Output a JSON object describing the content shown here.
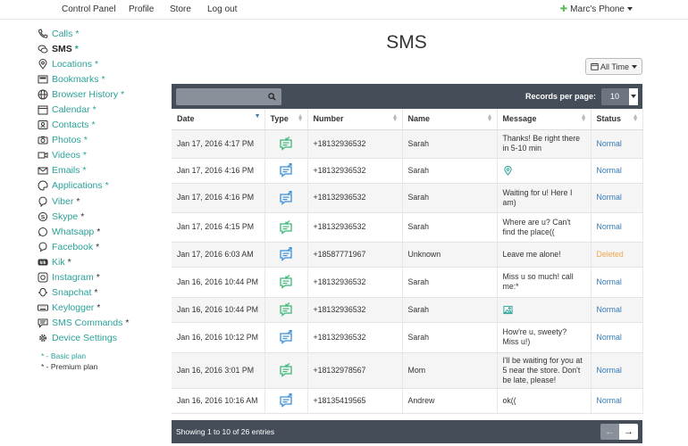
{
  "nav": {
    "control_panel": "Control Panel",
    "profile": "Profile",
    "store": "Store",
    "logout": "Log out",
    "device": "Marc's Phone"
  },
  "sidebar": {
    "items": [
      {
        "label": "Calls",
        "mark": "*",
        "tier": "basic",
        "icon": "phone-icon"
      },
      {
        "label": "SMS",
        "mark": "*",
        "tier": "basic",
        "icon": "chat-icon",
        "active": true
      },
      {
        "label": "Locations",
        "mark": "*",
        "tier": "basic",
        "icon": "map-pin-icon"
      },
      {
        "label": "Bookmarks",
        "mark": "*",
        "tier": "basic",
        "icon": "bookmark-icon"
      },
      {
        "label": "Browser History",
        "mark": "*",
        "tier": "basic",
        "icon": "globe-icon"
      },
      {
        "label": "Calendar",
        "mark": "*",
        "tier": "basic",
        "icon": "calendar-icon"
      },
      {
        "label": "Contacts",
        "mark": "*",
        "tier": "basic",
        "icon": "contacts-icon"
      },
      {
        "label": "Photos",
        "mark": "*",
        "tier": "basic",
        "icon": "camera-icon"
      },
      {
        "label": "Videos",
        "mark": "*",
        "tier": "basic",
        "icon": "video-icon"
      },
      {
        "label": "Emails",
        "mark": "*",
        "tier": "basic",
        "icon": "envelope-icon"
      },
      {
        "label": "Applications",
        "mark": "*",
        "tier": "basic",
        "icon": "palette-icon"
      },
      {
        "label": "Viber",
        "mark": "*",
        "tier": "premium",
        "icon": "viber-icon"
      },
      {
        "label": "Skype",
        "mark": "*",
        "tier": "premium",
        "icon": "skype-icon"
      },
      {
        "label": "Whatsapp",
        "mark": "*",
        "tier": "premium",
        "icon": "whatsapp-icon"
      },
      {
        "label": "Facebook",
        "mark": "*",
        "tier": "premium",
        "icon": "facebook-icon"
      },
      {
        "label": "Kik",
        "mark": "*",
        "tier": "premium",
        "icon": "kik-icon"
      },
      {
        "label": "Instagram",
        "mark": "*",
        "tier": "premium",
        "icon": "instagram-icon"
      },
      {
        "label": "Snapchat",
        "mark": "*",
        "tier": "premium",
        "icon": "snapchat-icon"
      },
      {
        "label": "Keylogger",
        "mark": "*",
        "tier": "premium",
        "icon": "keyboard-icon"
      },
      {
        "label": "SMS Commands",
        "mark": "*",
        "tier": "premium",
        "icon": "chat-lines-icon"
      },
      {
        "label": "Device Settings",
        "mark": "",
        "tier": "none",
        "icon": "gear-icon"
      }
    ],
    "legend_basic": "* - Basic plan",
    "legend_premium": "* - Premium plan"
  },
  "page": {
    "title": "SMS",
    "time_filter": "All Time"
  },
  "table": {
    "records_label": "Records per page:",
    "records_value": "10",
    "columns": [
      "Date",
      "Type",
      "Number",
      "Name",
      "Message",
      "Status"
    ],
    "rows": [
      {
        "date": "Jan 17, 2016 4:17 PM",
        "type": "incoming",
        "number": "+18132936532",
        "name": "Sarah",
        "message": "Thanks! Be right there in 5-10 min",
        "status": "Normal"
      },
      {
        "date": "Jan 17, 2016 4:16 PM",
        "type": "outgoing",
        "number": "+18132936532",
        "name": "Sarah",
        "message": "",
        "message_icon": "location-pin-icon",
        "status": "Normal"
      },
      {
        "date": "Jan 17, 2016 4:16 PM",
        "type": "outgoing",
        "number": "+18132936532",
        "name": "Sarah",
        "message": "Waiting for u! Here I am)",
        "status": "Normal"
      },
      {
        "date": "Jan 17, 2016 4:15 PM",
        "type": "incoming",
        "number": "+18132936532",
        "name": "Sarah",
        "message": "Where are u? Can't find the place((",
        "status": "Normal"
      },
      {
        "date": "Jan 17, 2016 6:03 AM",
        "type": "outgoing",
        "number": "+18587771967",
        "name": "Unknown",
        "message": "Leave me alone!",
        "status": "Deleted"
      },
      {
        "date": "Jan 16, 2016 10:44 PM",
        "type": "incoming",
        "number": "+18132936532",
        "name": "Sarah",
        "message": "Miss u so much! call me:*",
        "status": "Normal"
      },
      {
        "date": "Jan 16, 2016 10:44 PM",
        "type": "incoming",
        "number": "+18132936532",
        "name": "Sarah",
        "message": "",
        "message_icon": "image-icon",
        "status": "Normal"
      },
      {
        "date": "Jan 16, 2016 10:12 PM",
        "type": "outgoing",
        "number": "+18132936532",
        "name": "Sarah",
        "message": "How're u, sweety? Miss u!)",
        "status": "Normal"
      },
      {
        "date": "Jan 16, 2016 3:01 PM",
        "type": "incoming",
        "number": "+18132978567",
        "name": "Mom",
        "message": "I'll be waiting for you at 5 near the store. Don't be late, please!",
        "status": "Normal"
      },
      {
        "date": "Jan 16, 2016 10:16 AM",
        "type": "outgoing",
        "number": "+18135419565",
        "name": "Andrew",
        "message": "ok((",
        "status": "Normal"
      }
    ],
    "footer_info": "Showing 1 to 10 of 26 entries",
    "prev_label": "←",
    "next_label": "→"
  },
  "colors": {
    "accent": "#2aa198",
    "incoming": "#3cb878",
    "outgoing": "#3a8fd9",
    "status_normal": "#337ab7",
    "status_deleted": "#f0a64e",
    "panel": "#454d58"
  }
}
